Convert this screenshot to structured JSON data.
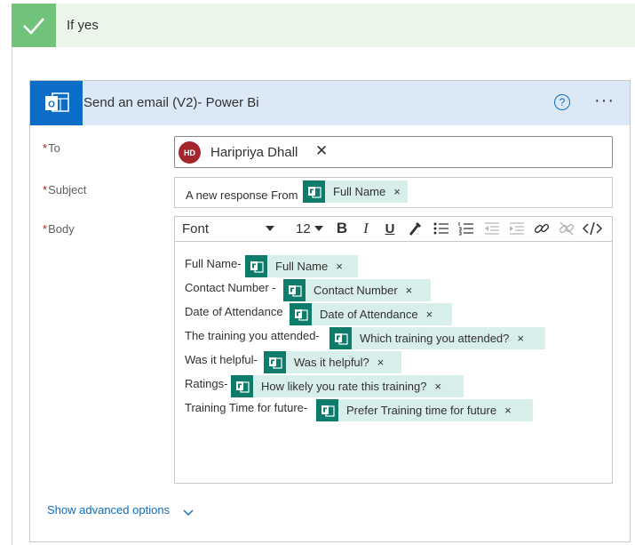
{
  "branch": {
    "title": "If yes"
  },
  "action": {
    "title": "Send an email (V2)- Power Bi",
    "help_glyph": "?",
    "more_glyph": "···"
  },
  "fields": {
    "to": {
      "required_mark": "*",
      "label": "To",
      "person": {
        "initials": "HD",
        "name": "Haripriya Dhall",
        "remove": "✕"
      }
    },
    "subject": {
      "required_mark": "*",
      "label": "Subject",
      "text": "A new response From",
      "token": {
        "label": "Full Name",
        "remove": "×"
      }
    },
    "body": {
      "required_mark": "*",
      "label": "Body",
      "toolbar": {
        "font": "Font",
        "size": "12",
        "bold": "B",
        "italic": "I",
        "underline": "U"
      },
      "lines": [
        {
          "text": "Full Name-",
          "token": "Full Name"
        },
        {
          "text": "Contact Number -",
          "token": "Contact Number"
        },
        {
          "text": "Date of Attendance",
          "token": "Date of Attendance"
        },
        {
          "text": "The training you attended-",
          "token": "Which training you attended?"
        },
        {
          "text": "Was it helpful-",
          "token": "Was it helpful?"
        },
        {
          "text": "Ratings-",
          "token": "How likely you rate this training?"
        },
        {
          "text": "Training Time for future-",
          "token": "Prefer Training time for future"
        }
      ],
      "token_remove": "×"
    }
  },
  "advanced": {
    "label": "Show advanced options"
  },
  "colors": {
    "success_green": "#70c379",
    "header_green_bg": "#e9f6e9",
    "action_header_bg": "#dbe9f7",
    "outlook_blue": "#0b6dc6",
    "forms_teal": "#0e7c6b",
    "token_bg": "#d8eeeb",
    "link_blue": "#0f6cbd",
    "avatar_red": "#a4262c"
  }
}
